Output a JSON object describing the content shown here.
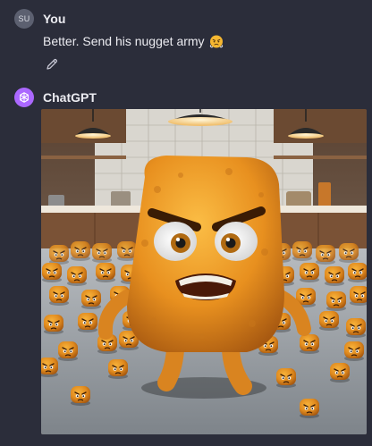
{
  "user_message": {
    "avatar_initials": "SU",
    "author": "You",
    "text": "Better. Send his nugget army",
    "emoji_icon": "face-with-steam-emoji",
    "edit_icon": "pencil-icon"
  },
  "assistant_message": {
    "author": "ChatGPT",
    "avatar_icon": "openai-logo-icon",
    "image_subject": "angry-chicken-nugget-army-image"
  },
  "colors": {
    "background": "#2b2d3a",
    "text": "#ececf1",
    "gpt_avatar": "#ab68ff",
    "user_avatar": "#5c6070"
  }
}
